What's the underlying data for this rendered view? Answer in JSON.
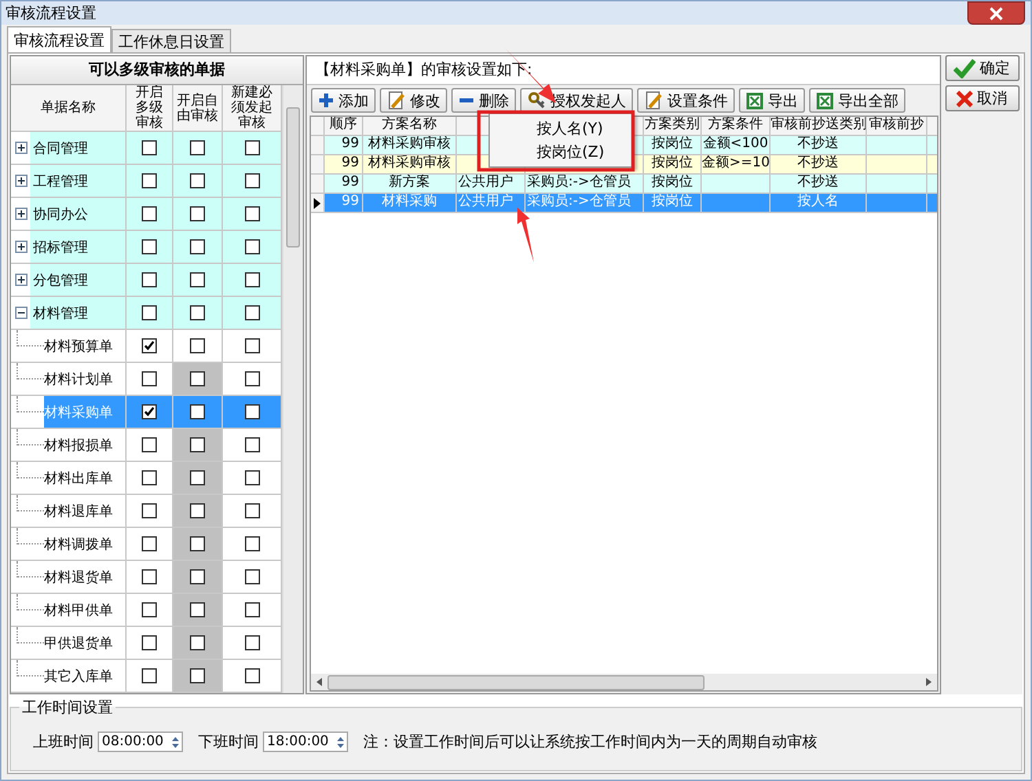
{
  "window": {
    "title": "审核流程设置"
  },
  "tabs": [
    {
      "label": "审核流程设置",
      "selected": true
    },
    {
      "label": "工作休息日设置",
      "selected": false
    }
  ],
  "bill_panel": {
    "title": "可以多级审核的单据",
    "columns": [
      "单据名称",
      "开启多级审核",
      "开启自由审核",
      "新建必须发起审核"
    ],
    "groups": [
      {
        "name": "合同管理",
        "expanded": false,
        "selected": false,
        "checks": [
          false,
          false,
          false
        ]
      },
      {
        "name": "工程管理",
        "expanded": false,
        "selected": false,
        "checks": [
          false,
          false,
          false
        ]
      },
      {
        "name": "协同办公",
        "expanded": false,
        "selected": false,
        "checks": [
          false,
          false,
          false
        ]
      },
      {
        "name": "招标管理",
        "expanded": false,
        "selected": false,
        "checks": [
          false,
          false,
          false
        ]
      },
      {
        "name": "分包管理",
        "expanded": false,
        "selected": false,
        "checks": [
          false,
          false,
          false
        ]
      },
      {
        "name": "材料管理",
        "expanded": true,
        "selected": false,
        "checks": [
          false,
          false,
          false
        ],
        "children": [
          {
            "name": "材料预算单",
            "selected": false,
            "free_disabled": false,
            "checks": [
              true,
              false,
              false
            ]
          },
          {
            "name": "材料计划单",
            "selected": false,
            "free_disabled": true,
            "checks": [
              false,
              false,
              false
            ]
          },
          {
            "name": "材料采购单",
            "selected": true,
            "free_disabled": true,
            "checks": [
              true,
              false,
              false
            ]
          },
          {
            "name": "材料报损单",
            "selected": false,
            "free_disabled": true,
            "checks": [
              false,
              false,
              false
            ]
          },
          {
            "name": "材料出库单",
            "selected": false,
            "free_disabled": true,
            "checks": [
              false,
              false,
              false
            ]
          },
          {
            "name": "材料退库单",
            "selected": false,
            "free_disabled": true,
            "checks": [
              false,
              false,
              false
            ]
          },
          {
            "name": "材料调拨单",
            "selected": false,
            "free_disabled": true,
            "checks": [
              false,
              false,
              false
            ]
          },
          {
            "name": "材料退货单",
            "selected": false,
            "free_disabled": true,
            "checks": [
              false,
              false,
              false
            ]
          },
          {
            "name": "材料甲供单",
            "selected": false,
            "free_disabled": true,
            "checks": [
              false,
              false,
              false
            ]
          },
          {
            "name": "甲供退货单",
            "selected": false,
            "free_disabled": true,
            "checks": [
              false,
              false,
              false
            ]
          },
          {
            "name": "其它入库单",
            "selected": false,
            "free_disabled": true,
            "checks": [
              false,
              false,
              false
            ]
          }
        ]
      }
    ]
  },
  "scheme_panel": {
    "caption": "【材料采购单】的审核设置如下:",
    "toolbar": [
      {
        "label": "添加",
        "kind": "add"
      },
      {
        "label": "修改",
        "kind": "edit"
      },
      {
        "label": "删除",
        "kind": "delete"
      },
      {
        "label": "授权发起人",
        "kind": "authorize"
      },
      {
        "label": "设置条件",
        "kind": "condition"
      },
      {
        "label": "导出",
        "kind": "export"
      },
      {
        "label": "导出全部",
        "kind": "export"
      }
    ],
    "columns": [
      {
        "label": "顺序"
      },
      {
        "label": "方案名称"
      },
      {},
      {},
      {
        "label": "方案类别"
      },
      {
        "label": "方案条件"
      },
      {
        "label": "审核前抄送类别"
      },
      {
        "label": "审核前抄"
      }
    ],
    "rows": [
      {
        "selected": false,
        "cells": [
          "99",
          "材料采购审核",
          null,
          null,
          "按岗位",
          "金额<100",
          "不抄送",
          null
        ]
      },
      {
        "selected": false,
        "cells": [
          "99",
          "材料采购审核",
          null,
          null,
          "按岗位",
          "金额>=10",
          "不抄送",
          null
        ]
      },
      {
        "selected": false,
        "cells": [
          "99",
          "新方案",
          "公共用户",
          "采购员:->仓管员",
          "按岗位",
          null,
          "不抄送",
          null
        ]
      },
      {
        "selected": true,
        "cells": [
          "99",
          "材料采购",
          "公共用户",
          "采购员:->仓管员",
          "按岗位",
          null,
          "按人名",
          null
        ]
      }
    ],
    "context_menu": [
      {
        "label": "按人名(Y)"
      },
      {
        "label": "按岗位(Z)"
      }
    ]
  },
  "buttons": [
    {
      "label": "确定",
      "kind": "ok"
    },
    {
      "label": "取消",
      "kind": "cancel"
    }
  ],
  "work_time": {
    "title": "工作时间设置",
    "start_label": "上班时间",
    "start_value": "08:00:00",
    "end_label": "下班时间",
    "end_value": "18:00:00",
    "note": "注：设置工作时间后可以让系统按工作时间内为一天的周期自动审核"
  }
}
